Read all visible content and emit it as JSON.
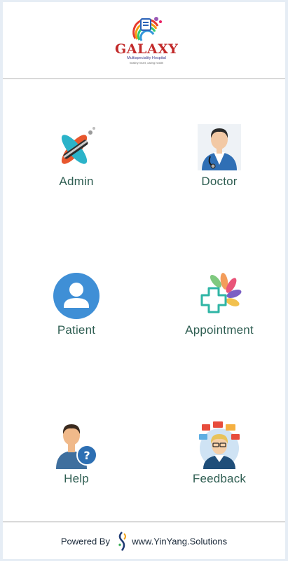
{
  "header": {
    "logo_title": "GALAXY",
    "logo_subtitle": "Multispeciality Hospital",
    "logo_tagline": "healthy heart, caring health",
    "logo_icon": "galaxy-logo-icon"
  },
  "menu": {
    "admin": {
      "label": "Admin",
      "icon": "admin-tools-icon"
    },
    "doctor": {
      "label": "Doctor",
      "icon": "doctor-icon"
    },
    "patient": {
      "label": "Patient",
      "icon": "patient-icon"
    },
    "appointment": {
      "label": "Appointment",
      "icon": "medical-cross-icon"
    },
    "help": {
      "label": "Help",
      "icon": "help-person-icon"
    },
    "feedback": {
      "label": "Feedback",
      "icon": "feedback-icon"
    }
  },
  "footer": {
    "powered_by": "Powered By",
    "site": "www.YinYang.Solutions"
  },
  "colors": {
    "label_text": "#2f5e52",
    "brand_red": "#c22a2a",
    "patient_blue": "#3f8fd6"
  }
}
